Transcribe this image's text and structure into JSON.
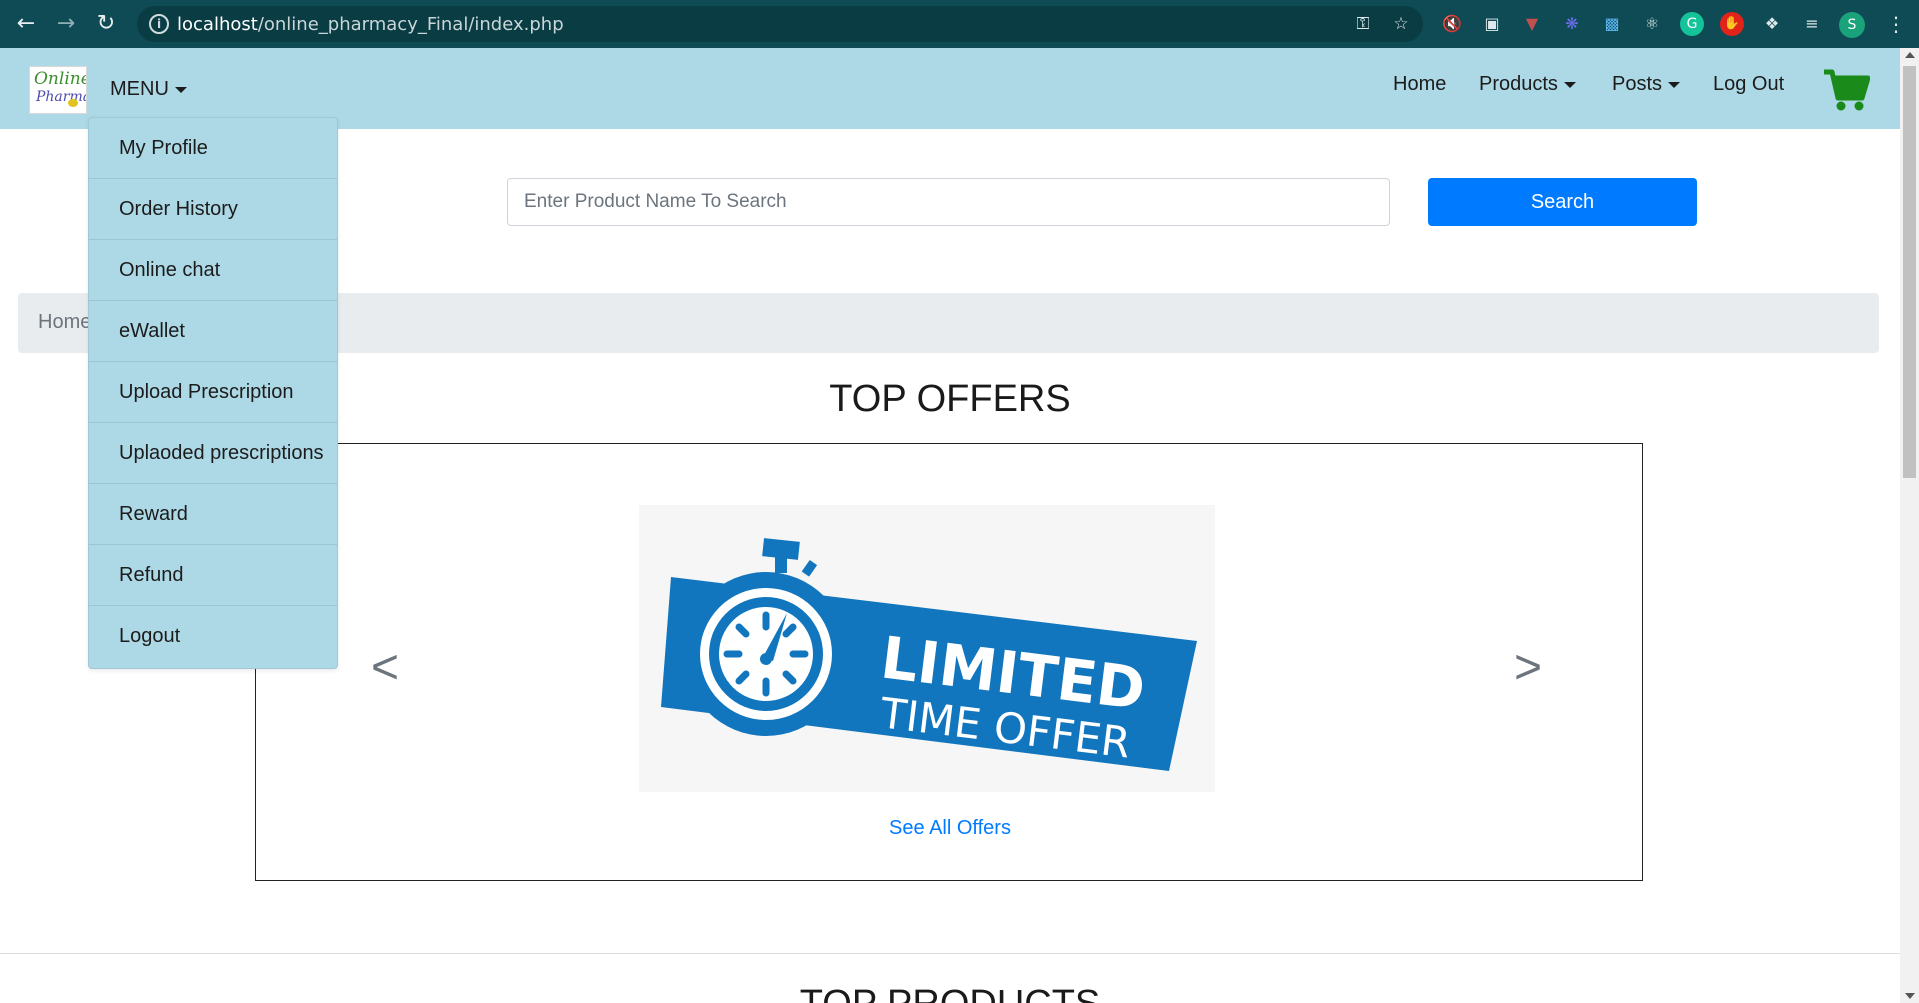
{
  "browser": {
    "url_host": "localhost",
    "url_path": "/online_pharmacy_Final/index.php",
    "profile_initial": "S"
  },
  "header": {
    "logo_text_line1": "Online",
    "logo_text_line2": "Pharmacy",
    "menu_label": "MENU",
    "nav": {
      "home": "Home",
      "products": "Products",
      "posts": "Posts",
      "logout": "Log Out"
    },
    "cart_color": "#1a8a1a"
  },
  "menu_dropdown": {
    "items": [
      {
        "label": "My Profile"
      },
      {
        "label": "Order History"
      },
      {
        "label": "Online chat"
      },
      {
        "label": "eWallet"
      },
      {
        "label": "Upload Prescription"
      },
      {
        "label": "Uplaoded prescriptions"
      },
      {
        "label": "Reward"
      },
      {
        "label": "Refund"
      },
      {
        "label": "Logout"
      }
    ]
  },
  "search": {
    "placeholder": "Enter Product Name To Search",
    "button_label": "Search"
  },
  "breadcrumb": {
    "current": "Home"
  },
  "offers": {
    "title": "TOP OFFERS",
    "prev_label": "<",
    "next_label": ">",
    "banner_line1": "LIMITED",
    "banner_line2": "TIME OFFER",
    "banner_color": "#1276be",
    "see_all_label": "See All Offers"
  },
  "products": {
    "title": "TOP PRODUCTS"
  },
  "colors": {
    "navbar_bg": "#add8e6",
    "primary": "#007bff",
    "chrome_bg": "#0e4b55"
  }
}
